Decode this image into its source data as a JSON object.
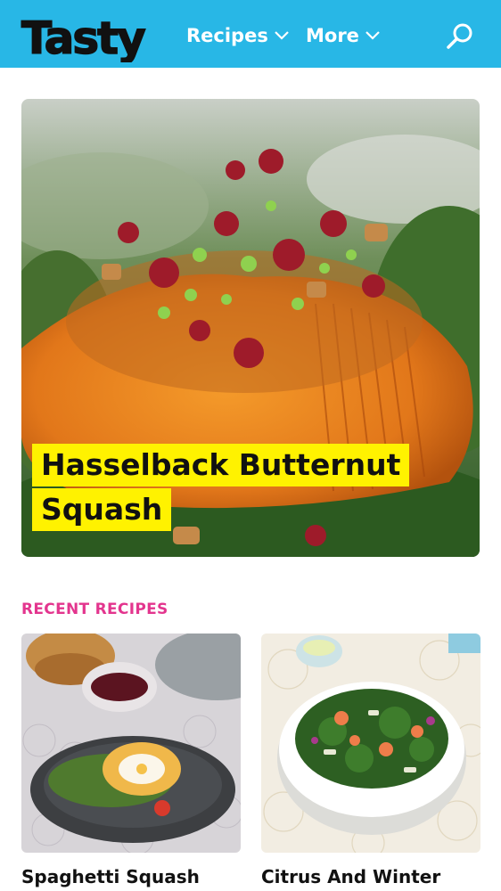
{
  "header": {
    "logo_text": "Tasty",
    "nav": [
      {
        "label": "Recipes"
      },
      {
        "label": "More"
      }
    ],
    "colors": {
      "bar": "#28b7e6",
      "text": "#ffffff"
    }
  },
  "hero": {
    "title_lines": [
      "Hasselback Butternut",
      "Squash"
    ],
    "highlight_color": "#fff200"
  },
  "recent": {
    "heading": "RECENT RECIPES",
    "heading_color": "#e3358e",
    "cards": [
      {
        "title": "Spaghetti Squash"
      },
      {
        "title": "Citrus And Winter"
      }
    ]
  },
  "icons": [
    "search-icon",
    "chevron-down-icon"
  ]
}
